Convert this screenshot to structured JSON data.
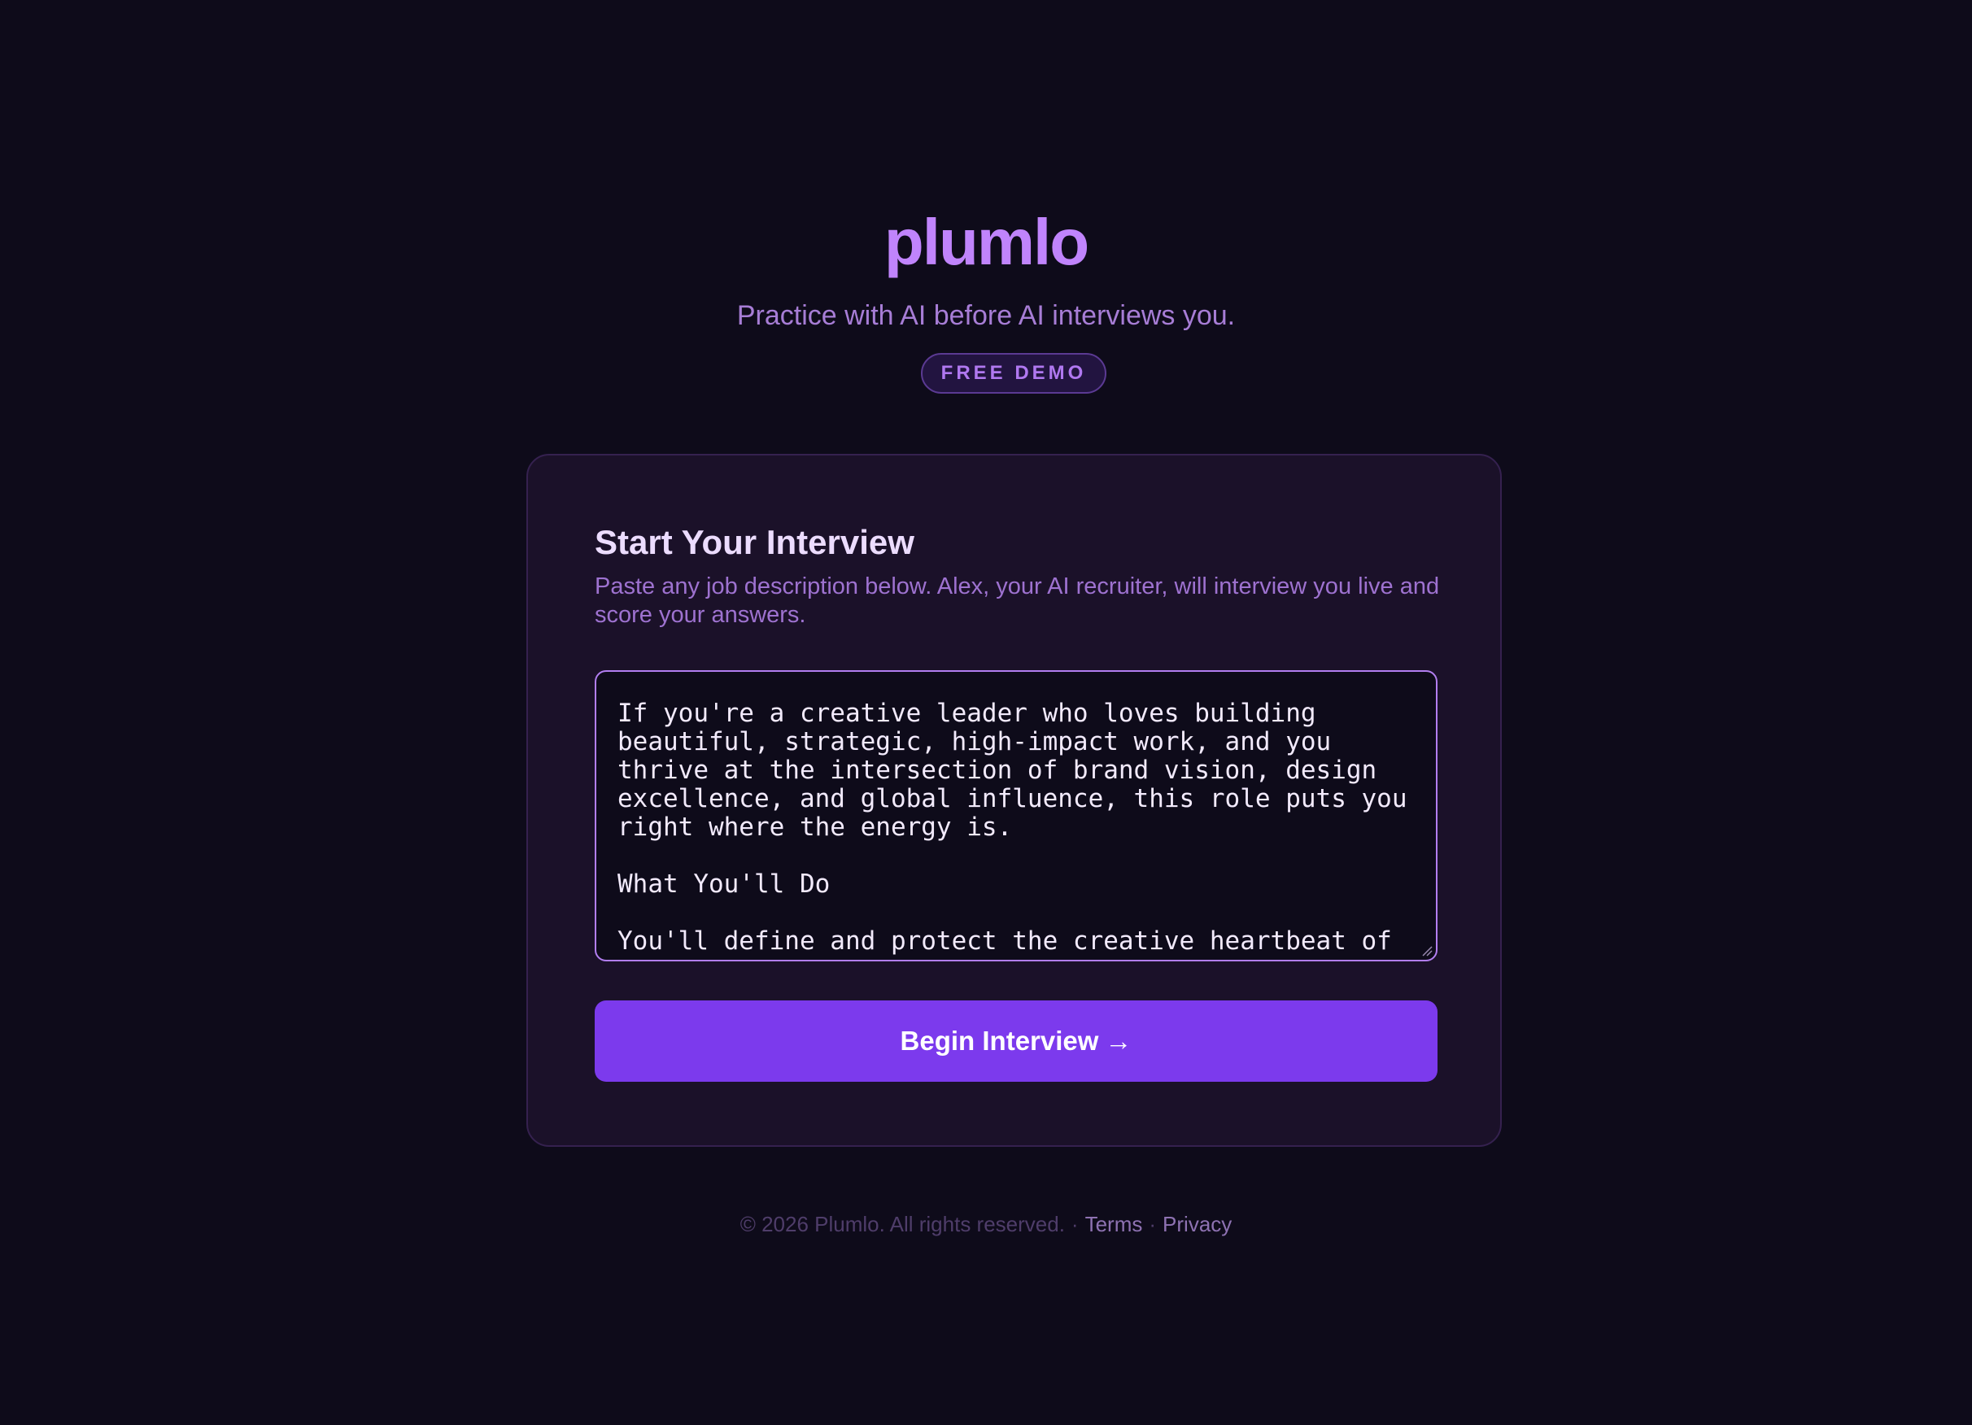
{
  "brand": {
    "name": "plumlo",
    "tagline": "Practice with AI before AI interviews you.",
    "badge": "FREE DEMO"
  },
  "card": {
    "title": "Start Your Interview",
    "description": "Paste any job description below. Alex, your AI recruiter, will interview you live and score your answers.",
    "job_description_value": "\n\nIf you're a creative leader who loves building beautiful, strategic, high-impact work, and you thrive at the intersection of brand vision, design excellence, and global influence, this role puts you right where the energy is.\n\nWhat You'll Do\n\nYou'll define and protect the creative heartbeat of",
    "begin_label": "Begin Interview",
    "begin_arrow": "→"
  },
  "footer": {
    "copyright": "© 2026 Plumlo. All rights reserved.",
    "separator": "·",
    "terms": "Terms",
    "privacy": "Privacy"
  },
  "colors": {
    "background": "#0e0b1a",
    "accent": "#7c3aed",
    "brand": "#c084fc",
    "card": "#1b1129"
  },
  "icons": {
    "resize": "resize-grip-icon",
    "arrow": "arrow-right-icon"
  }
}
